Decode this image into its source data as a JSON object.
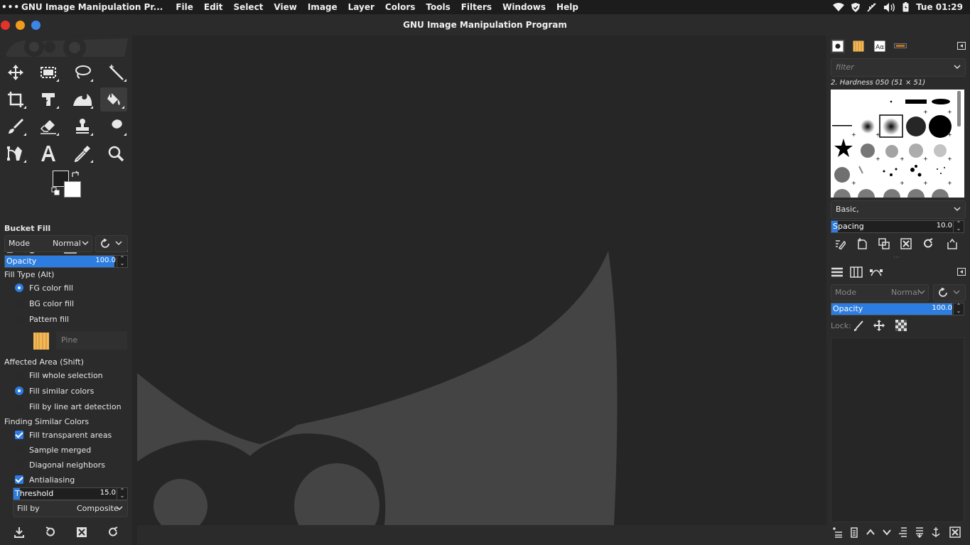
{
  "topbar": {
    "app_name": "GNU Image Manipulation Pr...",
    "menus": [
      "File",
      "Edit",
      "Select",
      "View",
      "Image",
      "Layer",
      "Colors",
      "Tools",
      "Filters",
      "Windows",
      "Help"
    ],
    "clock": "Tue 01:29"
  },
  "window": {
    "title": "GNU Image Manipulation Program",
    "colors": {
      "close": "#e5332a",
      "minimize": "#f09a1e",
      "maximize": "#3d86e8"
    }
  },
  "toolbox": {
    "tools": [
      "move-tool",
      "rectangle-select-tool",
      "free-select-tool",
      "fuzzy-select-tool",
      "crop-tool",
      "unified-transform-tool",
      "warp-transform-tool",
      "bucket-fill-tool",
      "paintbrush-tool",
      "eraser-tool",
      "clone-tool",
      "smudge-tool",
      "paths-tool",
      "text-tool",
      "color-picker-tool",
      "zoom-tool"
    ],
    "active_tool": "bucket-fill-tool",
    "fg_color": "#1e1e1e",
    "bg_color": "#ffffff"
  },
  "tool_options": {
    "title": "Bucket Fill",
    "mode_label": "Mode",
    "mode_value": "Normal",
    "opacity_label": "Opacity",
    "opacity_value": "100.0",
    "fill_type_label": "Fill Type  (Alt)",
    "fill_types": [
      "FG color fill",
      "BG color fill",
      "Pattern fill"
    ],
    "fill_type_selected": 0,
    "pattern_name": "Pine",
    "affected_area_label": "Affected Area  (Shift)",
    "affected_areas": [
      "Fill whole selection",
      "Fill similar colors",
      "Fill by line art detection"
    ],
    "affected_area_selected": 1,
    "finding_label": "Finding Similar Colors",
    "options": [
      {
        "label": "Fill transparent areas",
        "checked": true
      },
      {
        "label": "Sample merged",
        "checked": false
      },
      {
        "label": "Diagonal neighbors",
        "checked": false
      },
      {
        "label": "Antialiasing",
        "checked": true
      }
    ],
    "threshold_label": "Threshold",
    "threshold_value": "15.0",
    "threshold_fraction": 0.06,
    "fill_by_label": "Fill by",
    "fill_by_value": "Composite"
  },
  "brushes": {
    "filter_placeholder": "filter",
    "selected_brush": "2. Hardness 050 (51 × 51)",
    "preset": "Basic,",
    "spacing_label": "Spacing",
    "spacing_value": "10.0",
    "spacing_fraction": 0.05
  },
  "layers": {
    "mode_label": "Mode",
    "mode_value": "Normal",
    "opacity_label": "Opacity",
    "opacity_value": "100.0",
    "lock_label": "Lock:"
  },
  "colors": {
    "accent": "#2d7de0",
    "canvas_bg": "#262626",
    "wilber_shape": "#444444"
  }
}
